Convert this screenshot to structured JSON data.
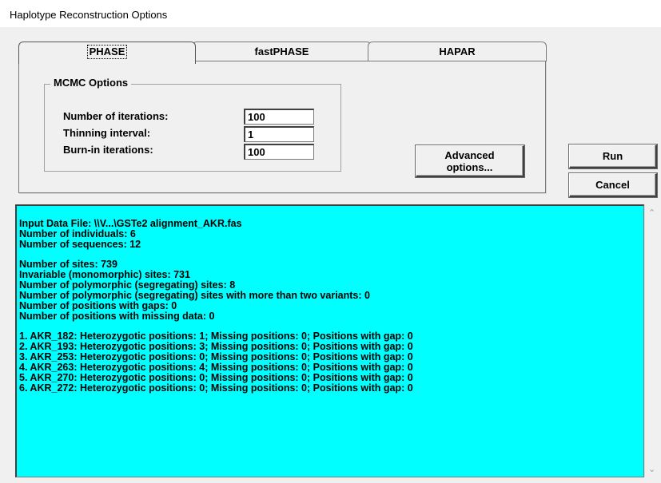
{
  "window": {
    "title": "Haplotype Reconstruction Options"
  },
  "tabs": [
    {
      "label": "PHASE",
      "active": true
    },
    {
      "label": "fastPHASE",
      "active": false
    },
    {
      "label": "HAPAR",
      "active": false
    }
  ],
  "mcmc": {
    "group_title": "MCMC Options",
    "iterations_label": "Number of iterations:",
    "iterations_value": "100",
    "thinning_label": "Thinning interval:",
    "thinning_value": "1",
    "burnin_label": "Burn-in iterations:",
    "burnin_value": "100"
  },
  "buttons": {
    "advanced_line1": "Advanced",
    "advanced_line2": "options...",
    "run": "Run",
    "cancel": "Cancel"
  },
  "output": {
    "background": "#00ffff",
    "lines": [
      "Input Data File: \\\\V...\\GSTe2 alignment_AKR.fas",
      "Number of individuals: 6",
      "Number of sequences: 12",
      "",
      "Number of sites: 739",
      "Invariable (monomorphic) sites: 731",
      "Number of polymorphic (segregating) sites: 8",
      "Number of polymorphic (segregating) sites with more than two variants: 0",
      "Number of positions with gaps: 0",
      "Number of positions with missing data: 0",
      "",
      "1. AKR_182: Heterozygotic positions: 1; Missing positions: 0; Positions with gap: 0",
      "2. AKR_193: Heterozygotic positions: 3; Missing positions: 0; Positions with gap: 0",
      "3. AKR_253: Heterozygotic positions: 0; Missing positions: 0; Positions with gap: 0",
      "4. AKR_263: Heterozygotic positions: 4; Missing positions: 0; Positions with gap: 0",
      "5. AKR_270: Heterozygotic positions: 0; Missing positions: 0; Positions with gap: 0",
      "6. AKR_272: Heterozygotic positions: 0; Missing positions: 0; Positions with gap: 0"
    ]
  },
  "scrollbar": {
    "up_icon": "chevron-up-icon",
    "down_icon": "chevron-down-icon"
  }
}
